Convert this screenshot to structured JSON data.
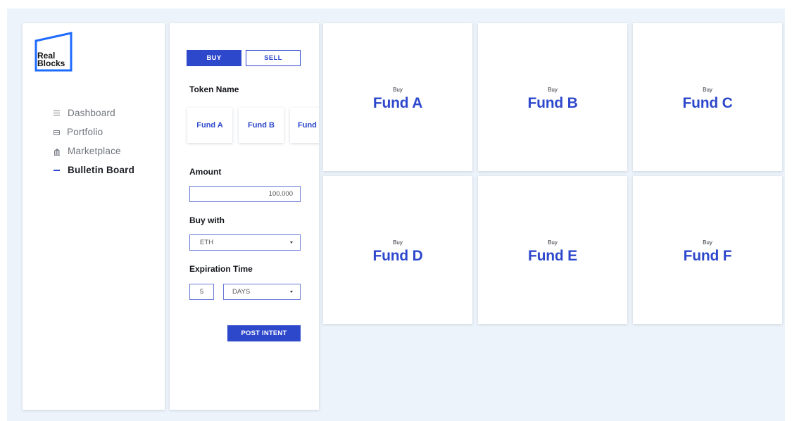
{
  "brand": {
    "logo_line1": "Real",
    "logo_line2": "Blocks",
    "accent": "#2e48cc"
  },
  "nav": {
    "items": [
      {
        "label": "Dashboard",
        "icon": "list-icon",
        "active": false
      },
      {
        "label": "Portfolio",
        "icon": "briefcase-icon",
        "active": false
      },
      {
        "label": "Marketplace",
        "icon": "bank-icon",
        "active": false
      },
      {
        "label": "Bulletin Board",
        "icon": "dash-icon",
        "active": true
      }
    ]
  },
  "form": {
    "buy_label": "BUY",
    "sell_label": "SELL",
    "selected_mode": "BUY",
    "token_name_label": "Token Name",
    "tokens": [
      "Fund A",
      "Fund B",
      "Fund"
    ],
    "amount_label": "Amount",
    "amount_value": "100.000",
    "buy_with_label": "Buy with",
    "buy_with_value": "ETH",
    "expiration_label": "Expiration Time",
    "expiration_value": "5",
    "expiration_unit": "DAYS",
    "post_label": "POST INTENT"
  },
  "funds": [
    {
      "buy": "Buy",
      "name": "Fund A"
    },
    {
      "buy": "Buy",
      "name": "Fund B"
    },
    {
      "buy": "Buy",
      "name": "Fund C"
    },
    {
      "buy": "Buy",
      "name": "Fund D"
    },
    {
      "buy": "Buy",
      "name": "Fund E"
    },
    {
      "buy": "Buy",
      "name": "Fund F"
    }
  ]
}
